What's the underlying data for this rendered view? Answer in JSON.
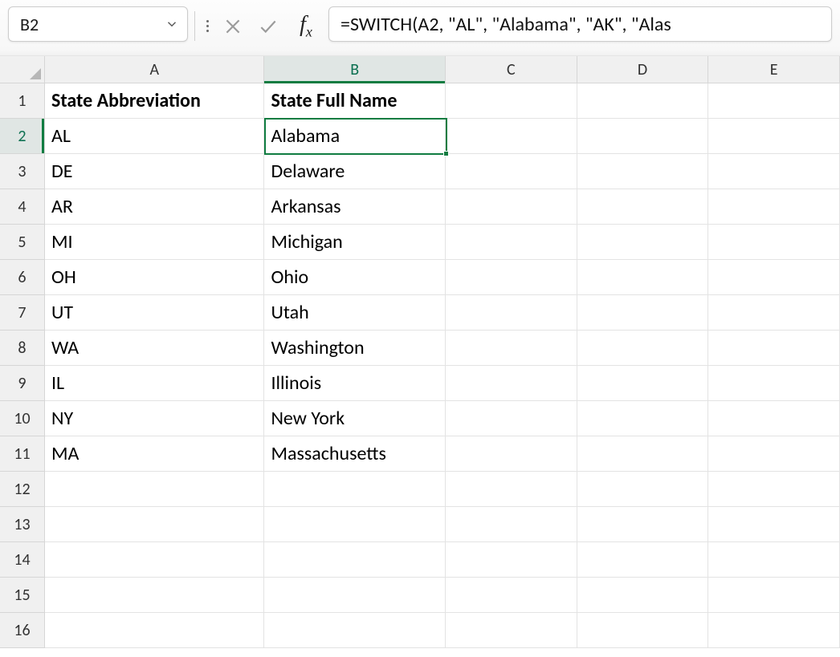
{
  "nameBox": {
    "value": "B2"
  },
  "formulaBar": {
    "value": "=SWITCH(A2, \"AL\", \"Alabama\", \"AK\", \"Alas"
  },
  "columns": [
    "A",
    "B",
    "C",
    "D",
    "E"
  ],
  "columnWidthsPx": {
    "A": 274,
    "B": 226,
    "C": 164,
    "D": 164,
    "E": 164
  },
  "activeColumn": "B",
  "activeRow": 2,
  "selectedCell": "B2",
  "rowCount": 16,
  "headers": {
    "A": "State Abbreviation",
    "B": "State Full Name"
  },
  "data": [
    {
      "abbr": "AL",
      "full": "Alabama"
    },
    {
      "abbr": "DE",
      "full": "Delaware"
    },
    {
      "abbr": "AR",
      "full": "Arkansas"
    },
    {
      "abbr": "MI",
      "full": "Michigan"
    },
    {
      "abbr": "OH",
      "full": "Ohio"
    },
    {
      "abbr": "UT",
      "full": "Utah"
    },
    {
      "abbr": "WA",
      "full": "Washington"
    },
    {
      "abbr": "IL",
      "full": "Illinois"
    },
    {
      "abbr": "NY",
      "full": "New York"
    },
    {
      "abbr": "MA",
      "full": "Massachusetts"
    }
  ],
  "colors": {
    "selection": "#107c41",
    "gridLine": "#e3e3e3",
    "headerBg": "#f0f0f0"
  }
}
